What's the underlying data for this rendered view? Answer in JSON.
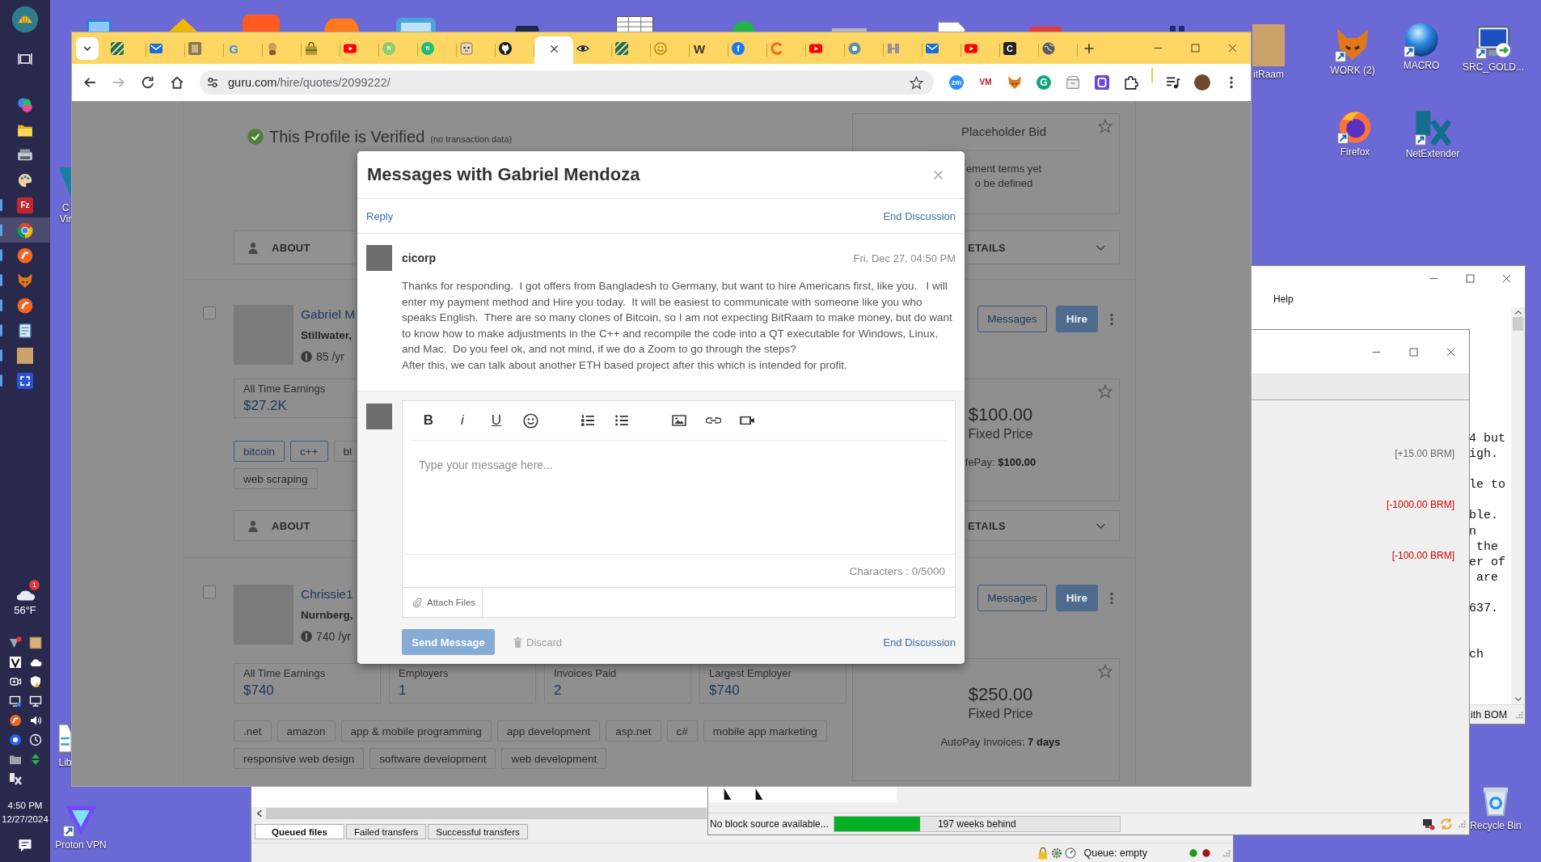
{
  "taskbar": {
    "apps": [
      {
        "kind": "swirl",
        "running": false,
        "selected": false
      },
      {
        "kind": "folder",
        "running": false,
        "selected": false
      },
      {
        "kind": "printer",
        "running": false,
        "selected": false
      },
      {
        "kind": "palette",
        "running": false,
        "selected": false
      },
      {
        "kind": "plate",
        "glyph": "Fz",
        "color": "#c1272d",
        "running": true,
        "selected": false
      },
      {
        "kind": "wheel",
        "running": true,
        "selected": true
      },
      {
        "kind": "disc",
        "running": true,
        "selected": false
      },
      {
        "kind": "fox",
        "running": true,
        "selected": false
      },
      {
        "kind": "disc",
        "running": true,
        "selected": false
      },
      {
        "kind": "notepad",
        "running": true,
        "selected": false
      },
      {
        "kind": "portrait",
        "running": true,
        "selected": false
      },
      {
        "kind": "expand",
        "running": true,
        "selected": false
      }
    ],
    "weather": {
      "badge": "1",
      "temperature": "56°F"
    },
    "clock": {
      "time": "4:50 PM",
      "date": "12/27/2024"
    }
  },
  "desktop_icons": [
    {
      "label": "itRaam",
      "kind": "portrait"
    },
    {
      "label": "WORK (2)",
      "kind": "fox"
    },
    {
      "label": "MACRO",
      "kind": "sphere"
    },
    {
      "label": "SRC_GOLD...",
      "kind": "computer"
    },
    {
      "label": "Firefox",
      "kind": "flame"
    },
    {
      "label": "NetExtender",
      "kind": "cross"
    },
    {
      "label": "C Vir",
      "kind": "wedge"
    },
    {
      "label": "Lib",
      "kind": "document"
    },
    {
      "label": "Proton VPN",
      "kind": "triangle"
    },
    {
      "label": "Recycle Bin",
      "kind": "bin"
    }
  ],
  "browser": {
    "tabs": [
      {
        "kind": "stripes",
        "selected": false
      },
      {
        "kind": "envelope",
        "selected": false
      },
      {
        "kind": "tile",
        "selected": false
      },
      {
        "kind": "letter",
        "glyph": "G",
        "color": "#4285f4",
        "selected": false
      },
      {
        "kind": "figure",
        "selected": false
      },
      {
        "kind": "bag",
        "selected": false
      },
      {
        "kind": "play",
        "selected": false
      },
      {
        "kind": "badge",
        "glyph": "fi",
        "color": "#8ccf6b",
        "selected": false
      },
      {
        "kind": "badge",
        "glyph": "fi",
        "color": "#1dbf73",
        "selected": false
      },
      {
        "kind": "robot",
        "selected": false
      },
      {
        "kind": "cat",
        "selected": false
      },
      {
        "selected": true
      },
      {
        "kind": "eye",
        "selected": false
      },
      {
        "kind": "stripes",
        "selected": false
      },
      {
        "kind": "smile",
        "selected": false
      },
      {
        "kind": "letter",
        "glyph": "W",
        "color": "#333333",
        "selected": false
      },
      {
        "kind": "badge",
        "glyph": "f",
        "color": "#1877f2",
        "selected": false
      },
      {
        "kind": "ring",
        "selected": false
      },
      {
        "kind": "play",
        "selected": false
      },
      {
        "kind": "aperture",
        "selected": false
      },
      {
        "kind": "grid",
        "selected": false
      },
      {
        "kind": "envelope",
        "selected": false
      },
      {
        "kind": "play",
        "selected": false
      },
      {
        "kind": "plate",
        "glyph": "C",
        "color": "#222222",
        "selected": false
      },
      {
        "kind": "globe",
        "selected": false
      }
    ],
    "forward": {
      "disabled": true
    },
    "url": {
      "host": "guru.com",
      "path": "/hire/quotes/2099222/"
    },
    "bookmarked": false,
    "extensions": [
      {
        "kind": "badge",
        "glyph": "zm",
        "color": "#2d8cff"
      },
      {
        "kind": "letter",
        "glyph": "VM",
        "color": "#c8102e"
      },
      {
        "kind": "fox"
      },
      {
        "kind": "badge",
        "glyph": "G",
        "color": "#15a37f"
      },
      {
        "kind": "box"
      },
      {
        "kind": "frame"
      },
      {
        "kind": "puzzle"
      }
    ]
  },
  "page": {
    "profile": {
      "verified": "This Profile is Verified",
      "note": "(no transaction data)",
      "bid": {
        "title": "Placeholder Bid",
        "lines": [
          "ement terms yet",
          "o be defined"
        ],
        "starred": false
      },
      "about": "ABOUT",
      "details": "ETAILS"
    },
    "freelancers": [
      {
        "selected": false,
        "name": "Gabriel M",
        "location": "Stillwater,",
        "rate": "85 /yr",
        "stats": [
          {
            "label": "All Time Earnings",
            "value": "$27.2K"
          }
        ],
        "tag_rows": [
          [
            {
              "label": "bitcoin",
              "kind": "match"
            },
            {
              "label": "c++",
              "kind": "match"
            },
            {
              "label": "bl",
              "kind": "plain"
            }
          ],
          [
            {
              "label": "web scraping",
              "kind": "plain"
            }
          ]
        ],
        "about": "ABOUT",
        "actions": {
          "messages": "Messages",
          "hire": "Hire"
        },
        "price": {
          "amount": "$100.00",
          "type": "Fixed Price",
          "note": "fePay: **$100.00**",
          "starred": false
        },
        "details": "ETAILS"
      },
      {
        "selected": false,
        "name": "Chrissie1",
        "location": "Nurnberg,",
        "rate": "740 /yr",
        "stats": [
          {
            "label": "All Time Earnings",
            "value": "$740"
          },
          {
            "label": "Employers",
            "value": "1"
          },
          {
            "label": "Invoices Paid",
            "value": "2"
          },
          {
            "label": "Largest Employer",
            "value": "$740"
          }
        ],
        "tag_rows": [
          [
            {
              "label": ".net",
              "kind": "plain"
            },
            {
              "label": "amazon",
              "kind": "plain"
            },
            {
              "label": "app & mobile programming",
              "kind": "plain"
            },
            {
              "label": "app development",
              "kind": "plain"
            },
            {
              "label": "asp.net",
              "kind": "plain"
            },
            {
              "label": "c#",
              "kind": "plain"
            },
            {
              "label": "mobile app marketing",
              "kind": "plain"
            }
          ],
          [
            {
              "label": "responsive web design",
              "kind": "plain"
            },
            {
              "label": "software development",
              "kind": "plain"
            },
            {
              "label": "web development",
              "kind": "plain"
            }
          ]
        ],
        "actions": {
          "messages": "Messages",
          "hire": "Hire"
        },
        "price": {
          "amount": "$250.00",
          "type": "Fixed Price",
          "note": "AutoPay Invoices: **7 days**",
          "starred": false
        }
      }
    ]
  },
  "modal": {
    "title": "Messages with Gabriel Mendoza",
    "reply": "Reply",
    "end_discussion": "End Discussion",
    "message": {
      "sender": "cicorp",
      "time": "Fri, Dec 27, 04:50 PM",
      "paragraphs": [
        "Thanks for responding.  I got offers from Bangladesh to Germany, but want to hire Americans first, like you.   I will enter my payment method and Hire you today.  It will be easiest to communicate with someone like you who speaks English.  There are so many clones of Bitcoin, so I am not expecting BitRaam to make money, but do want to know how to make adjustments in the C++ and recompile the code into a QT executable for Windows, Linux, and Mac.  Do you feel ok, and not mind, if we do a Zoom to go through the steps?",
        "After this, we can talk about another ETH based project after this which is intended for profit."
      ]
    },
    "composer": {
      "tools": [
        {
          "kind": "bold",
          "glyph": "B"
        },
        {
          "kind": "italic",
          "glyph": "i"
        },
        {
          "kind": "underline",
          "glyph": "U"
        },
        {
          "kind": "emoji"
        },
        {
          "kind": "ordered-list"
        },
        {
          "kind": "bullet-list"
        },
        {
          "kind": "image"
        },
        {
          "kind": "link"
        },
        {
          "kind": "video"
        }
      ],
      "placeholder": "Type your message here...",
      "counter": "Characters : 0/5000",
      "attach": "Attach Files"
    },
    "send": {
      "label": "Send Message",
      "disabled": true
    },
    "discard": {
      "label": "Discard",
      "disabled": true
    },
    "footer_end_discussion": "End Discussion"
  },
  "notepad_window": {
    "menu": "Help",
    "text": "4 but\nigh.\n\nle to\n\nble.\nn\n the\ner of\n are\n\n637.\n\n\nch",
    "status": "ith BOM"
  },
  "wallet_window": {
    "amounts": [
      {
        "text": "[+15.00 BRM]",
        "kind": "credit"
      },
      {
        "text": "[-1000.00 BRM]",
        "kind": "debit"
      },
      {
        "text": "[-100.00 BRM]",
        "kind": "debit"
      }
    ],
    "status": "No block source available...",
    "sync": {
      "label": "197 weeks behind",
      "level": 0.3
    }
  },
  "filezilla_window": {
    "queue_tabs": [
      {
        "label": "Queued files",
        "selected": true
      },
      {
        "label": "Failed transfers",
        "selected": false
      },
      {
        "label": "Successful transfers",
        "selected": false
      }
    ],
    "status": "Queue: empty"
  }
}
